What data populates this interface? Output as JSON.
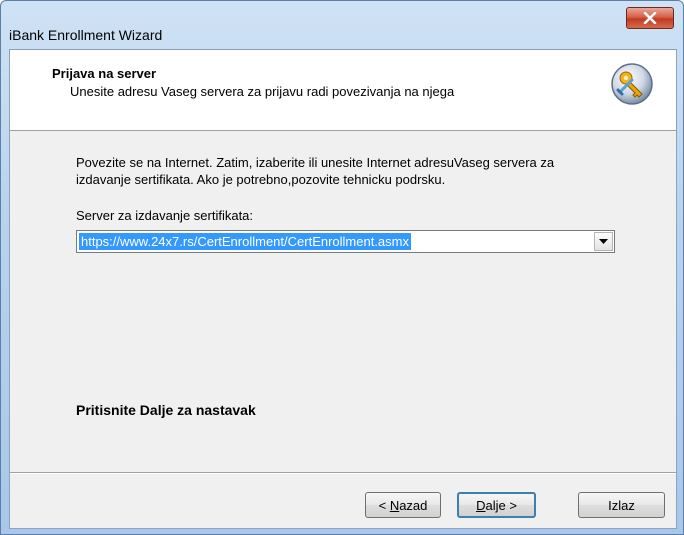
{
  "window": {
    "title": "iBank Enrollment Wizard",
    "close_icon": "close-icon"
  },
  "header": {
    "title": "Prijava na server",
    "subtitle": "Unesite adresu Vaseg servera za prijavu radi povezivanja na njega",
    "icon": "wizard-keys-icon"
  },
  "body": {
    "description_line1": "Povezite se na Internet. Zatim, izaberite ili unesite Internet adresuVaseg servera za",
    "description_line2": "izdavanje sertifikata. Ako je potrebno,pozovite tehnicku podrsku.",
    "server_label": "Server za izdavanje sertifikata:",
    "server_value": "https://www.24x7.rs/CertEnrollment/CertEnrollment.asmx",
    "footer_note": "Pritisnite Dalje za nastavak"
  },
  "buttons": {
    "back_prefix": "< ",
    "back_mnemonic": "N",
    "back_rest": "azad",
    "next_mnemonic": "D",
    "next_rest": "alje >",
    "exit": "Izlaz"
  },
  "colors": {
    "selection": "#3399ff",
    "close_button": "#c23a22"
  }
}
